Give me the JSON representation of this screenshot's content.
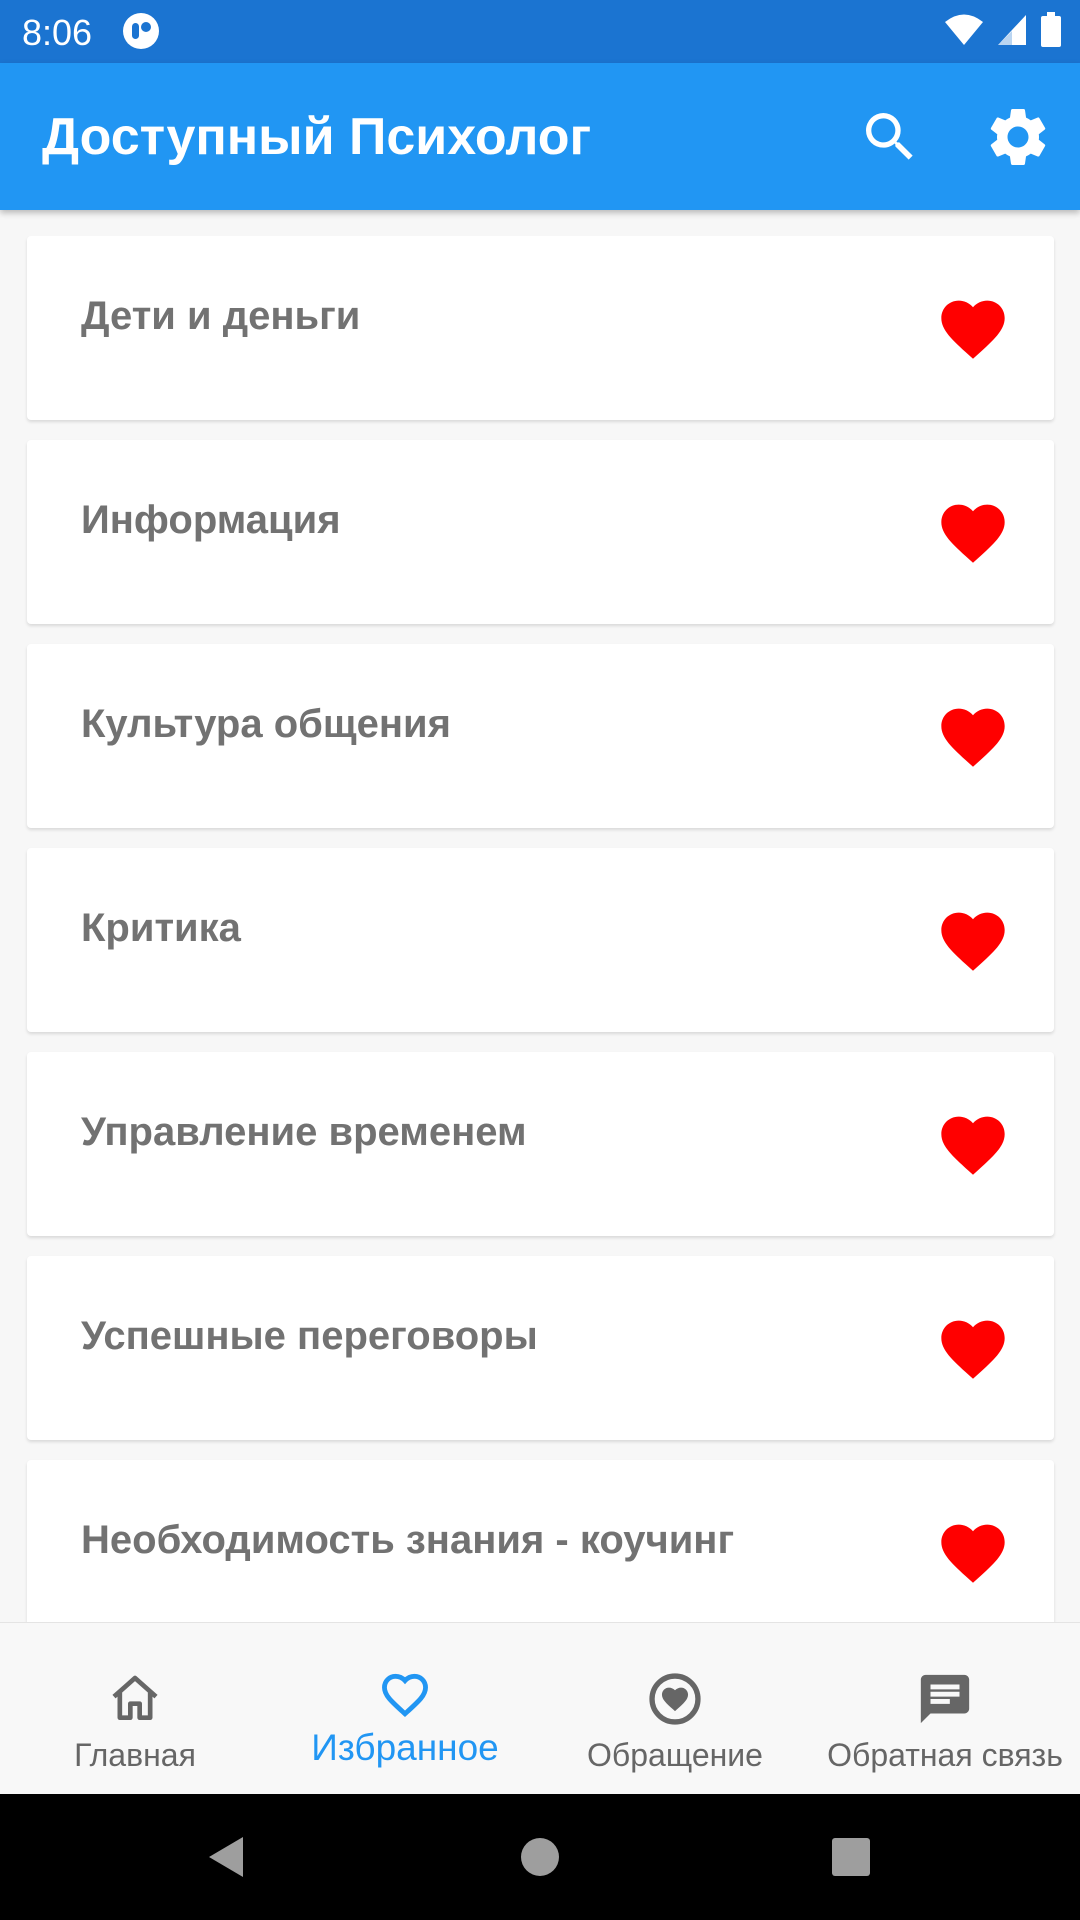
{
  "status_bar": {
    "time": "8:06",
    "icons": [
      "app-notification-icon",
      "wifi-icon",
      "signal-icon",
      "battery-icon"
    ]
  },
  "app_bar": {
    "title": "Доступный Психолог",
    "actions": [
      "search-icon",
      "gear-icon"
    ],
    "color": "#2196f3"
  },
  "favorites": [
    {
      "label": "Дети и деньги",
      "favorited": true
    },
    {
      "label": "Информация",
      "favorited": true
    },
    {
      "label": "Культура общения",
      "favorited": true
    },
    {
      "label": "Критика",
      "favorited": true
    },
    {
      "label": "Управление временем",
      "favorited": true
    },
    {
      "label": "Успешные переговоры",
      "favorited": true
    },
    {
      "label": "Необходимость знания - коучинг",
      "favorited": true
    }
  ],
  "heart_color": "#ff0000",
  "bottom_nav": {
    "items": [
      {
        "label": "Главная",
        "icon": "home-icon",
        "active": false
      },
      {
        "label": "Избранное",
        "icon": "heart-outline-icon",
        "active": true
      },
      {
        "label": "Обращение",
        "icon": "heart-circle-icon",
        "active": false
      },
      {
        "label": "Обратная связь",
        "icon": "feedback-icon",
        "active": false
      }
    ],
    "active_color": "#2196f3"
  },
  "system_nav": [
    "back-icon",
    "home-circle-icon",
    "recents-icon"
  ]
}
